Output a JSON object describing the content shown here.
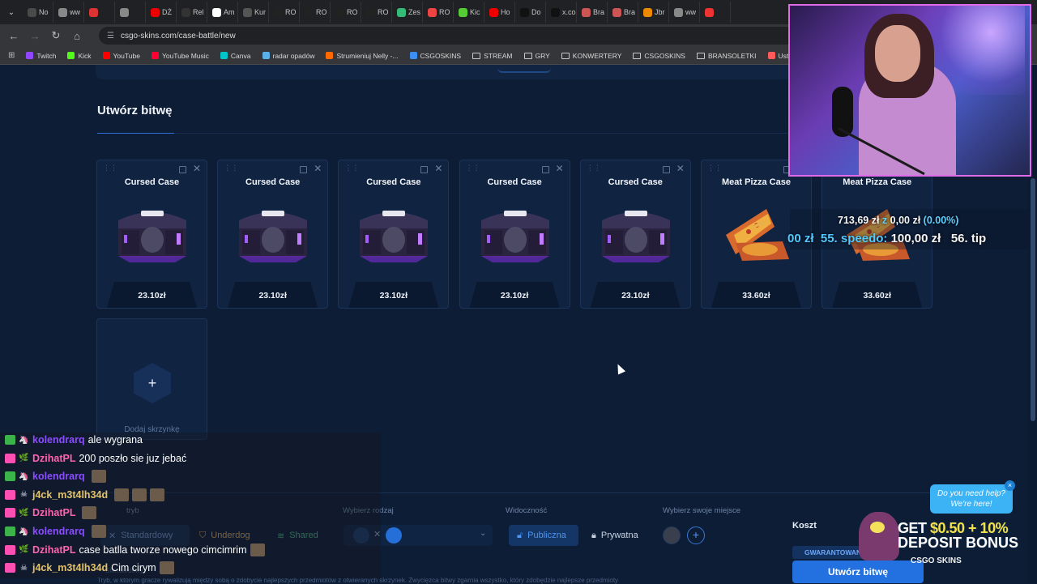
{
  "browser": {
    "tabs": [
      "No",
      "ww",
      "",
      "",
      "DŻ",
      "Rel",
      "Am",
      "Kur",
      "RO",
      "RO",
      "RO",
      "RO",
      "Zes",
      "RO",
      "Kic",
      "Ho",
      "Do",
      "x.co",
      "Bra",
      "Bra",
      "Jbr",
      "ww",
      ""
    ],
    "tab_colors": [
      "#4a4a4a",
      "#888",
      "#d33",
      "#888",
      "#e00",
      "#333",
      "#fff",
      "#555",
      "#222",
      "#222",
      "#222",
      "#222",
      "#3b7",
      "#e44",
      "#5c3",
      "#e00",
      "#111",
      "#111",
      "#c55",
      "#c55",
      "#e80",
      "#888",
      "#e33"
    ],
    "url": "csgo-skins.com/case-battle/new",
    "bookmarks": [
      {
        "label": "Twitch",
        "color": "#9146ff",
        "type": "site"
      },
      {
        "label": "Kick",
        "color": "#53fc18",
        "type": "site"
      },
      {
        "label": "YouTube",
        "color": "#ff0000",
        "type": "site"
      },
      {
        "label": "YouTube Music",
        "color": "#ff0033",
        "type": "site"
      },
      {
        "label": "Canva",
        "color": "#00c4cc",
        "type": "site"
      },
      {
        "label": "radar opadów",
        "color": "#5ab0e8",
        "type": "site"
      },
      {
        "label": "Strumieniuj Nelly -...",
        "color": "#ff6a00",
        "type": "site"
      },
      {
        "label": "CSGOSKINS",
        "color": "#3b8ff0",
        "type": "site"
      },
      {
        "label": "STREAM",
        "type": "folder"
      },
      {
        "label": "GRY",
        "type": "folder"
      },
      {
        "label": "KONWERTERY",
        "type": "folder"
      },
      {
        "label": "CSGOSKINS",
        "type": "folder"
      },
      {
        "label": "BRANSOLETKI",
        "type": "folder"
      },
      {
        "label": "Ustawienia strumien...",
        "color": "#ff5a5a",
        "type": "site"
      }
    ]
  },
  "page": {
    "title": "Utwórz bitwę",
    "cases": [
      {
        "name": "Cursed Case",
        "price": "23.10zł",
        "kind": "cursed"
      },
      {
        "name": "Cursed Case",
        "price": "23.10zł",
        "kind": "cursed"
      },
      {
        "name": "Cursed Case",
        "price": "23.10zł",
        "kind": "cursed"
      },
      {
        "name": "Cursed Case",
        "price": "23.10zł",
        "kind": "cursed"
      },
      {
        "name": "Cursed Case",
        "price": "23.10zł",
        "kind": "cursed"
      },
      {
        "name": "Meat Pizza Case",
        "price": "33.60zł",
        "kind": "pizza"
      },
      {
        "name": "Meat Pizza Case",
        "price": "33.60zł",
        "kind": "pizza"
      }
    ],
    "add_case_label": "Dodaj skrzynkę",
    "add_plus": "+",
    "mode_label": "tryb",
    "modes": [
      "Standardowy",
      "Underdog",
      "Shared"
    ],
    "type_label": "Wybierz rodzaj",
    "visibility_label": "Widoczność",
    "visibility": [
      "Publiczna",
      "Prywatna"
    ],
    "seat_label": "Wybierz swoje miejsce",
    "seat_add": "+",
    "mode_caption": "Standardowy",
    "description": "Tryb, w którym gracze rywalizują między sobą o zdobycie najlepszych przedmiotów z otwieranych skrzynek. Zwycięzca bitwy zgarnia wszystko, który zdobędzie najlepsze przedmioty",
    "cost_label": "Koszt",
    "guarantee_label": "GWARANTOWAN",
    "create_button": "Utwórz bitwę"
  },
  "overlay": {
    "ticker_amount": "713,69 zł",
    "ticker_z": "z",
    "ticker_goal": "0,00 zł",
    "ticker_pct": "(0.00%)",
    "ticker_line_a": "00 zł",
    "ticker_line_b": "55. speedo:",
    "ticker_line_c": "100,00 zł",
    "ticker_line_d": "56. tip"
  },
  "chat": [
    {
      "user": "kolendrarq",
      "color": "#8a4dff",
      "text": "ale wygrana",
      "b1": "#3bb34a",
      "b2": "🦄",
      "emotes": 0
    },
    {
      "user": "DzihatPL",
      "color": "#ff63b1",
      "text": "200 poszło sie juz jebać",
      "b1": "#ff4fb3",
      "b2": "🌿",
      "emotes": 0
    },
    {
      "user": "kolendrarq",
      "color": "#8a4dff",
      "text": "",
      "b1": "#3bb34a",
      "b2": "🦄",
      "emotes": 1
    },
    {
      "user": "j4ck_m3t4lh34d",
      "color": "#e3c26a",
      "text": "",
      "b1": "#ff4fb3",
      "b2": "☠",
      "emotes": 3
    },
    {
      "user": "DzihatPL",
      "color": "#ff63b1",
      "text": "",
      "b1": "#ff4fb3",
      "b2": "🌿",
      "emotes": 1
    },
    {
      "user": "kolendrarq",
      "color": "#8a4dff",
      "text": "",
      "b1": "#3bb34a",
      "b2": "🦄",
      "emotes": 1
    },
    {
      "user": "DzihatPL",
      "color": "#ff63b1",
      "text": "case batlla tworze nowego cimcimrim",
      "b1": "#ff4fb3",
      "b2": "🌿",
      "emotes": 1
    },
    {
      "user": "j4ck_m3t4lh34d",
      "color": "#e3c26a",
      "text": "Cim cirym",
      "b1": "#ff4fb3",
      "b2": "☠",
      "emotes": 1
    }
  ],
  "ad": {
    "help_line1": "Do you need help?",
    "help_line2": "We're here!",
    "help_close": "×",
    "line1_prefix": "GET ",
    "line1_amount": "$0.50 + 10%",
    "line2": "DEPOSIT BONUS",
    "brand": "CSGO SKINS"
  }
}
